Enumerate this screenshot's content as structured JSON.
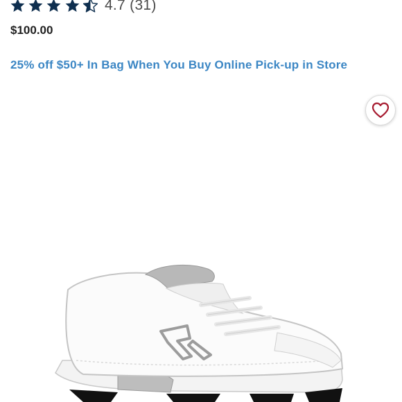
{
  "product": {
    "rating": {
      "value": 4.7,
      "max": 5,
      "stars": [
        "full",
        "full",
        "full",
        "full",
        "half"
      ],
      "text": "4.7 (31)",
      "star_color": "#0f2f4f"
    },
    "price": "$100.00",
    "promo": "25% off $50+ In Bag When You Buy Online Pick-up in Store",
    "promo_color": "#3b86c4",
    "favorite": {
      "icon": "heart-icon",
      "color": "#a6192e"
    },
    "image": {
      "alt": "White softball turf shoe",
      "icon": "sneaker-image"
    }
  }
}
